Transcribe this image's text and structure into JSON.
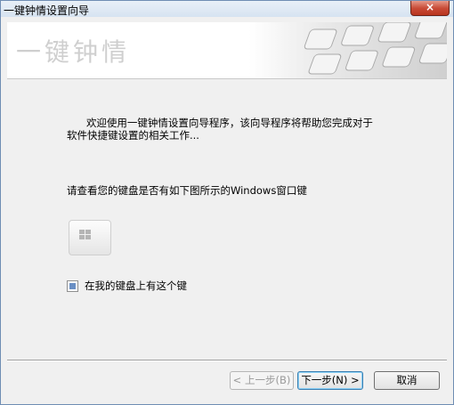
{
  "window": {
    "title": "一键钟情设置向导",
    "close_label": "×"
  },
  "header": {
    "logo_text": "一键钟情"
  },
  "content": {
    "intro_line1": "欢迎使用一键钟情设置向导程序，该向导程序将帮助您完成对于",
    "intro_line2": "软件快捷键设置的相关工作...",
    "question": "请查看您的键盘是否有如下图所示的Windows窗口键",
    "checkbox_label": "在我的键盘上有这个键",
    "checkbox_checked": true
  },
  "buttons": {
    "back": "< 上一步(B)",
    "next": "下一步(N) >",
    "cancel": "取消"
  }
}
